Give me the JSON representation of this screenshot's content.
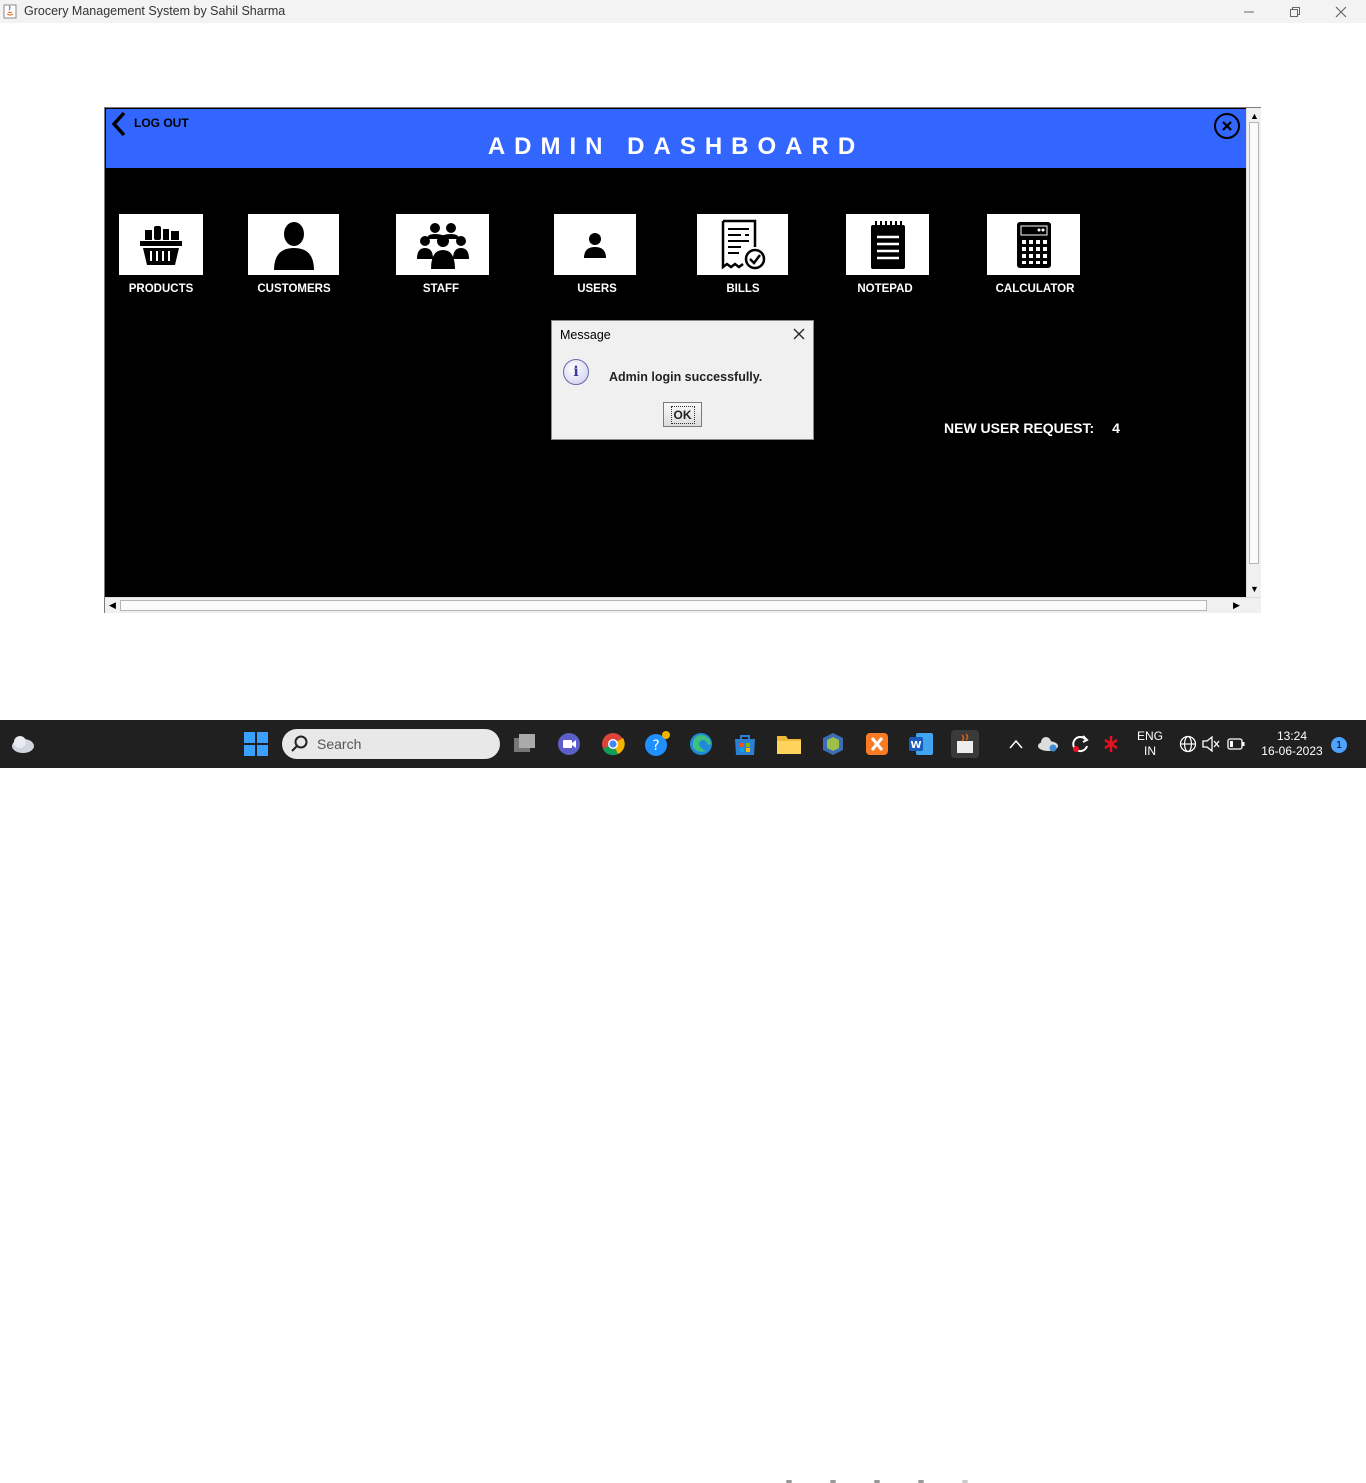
{
  "window": {
    "title": "Grocery Management System by Sahil Sharma"
  },
  "header": {
    "logout_label": "LOG OUT",
    "title": "ADMIN DASHBOARD"
  },
  "tiles": [
    {
      "label": "PRODUCTS",
      "icon": "grocery-basket-icon"
    },
    {
      "label": "CUSTOMERS",
      "icon": "person-icon"
    },
    {
      "label": "STAFF",
      "icon": "group-icon"
    },
    {
      "label": "USERS",
      "icon": "user-icon"
    },
    {
      "label": "BILLS",
      "icon": "bill-check-icon"
    },
    {
      "label": "NOTEPAD",
      "icon": "notepad-icon"
    },
    {
      "label": "CALCULATOR",
      "icon": "calculator-icon"
    }
  ],
  "requests": {
    "label": "NEW USER REQUEST:",
    "count": "4"
  },
  "dialog": {
    "title": "Message",
    "message": "Admin login successfully.",
    "ok_label": "OK"
  },
  "taskbar": {
    "search_placeholder": "Search",
    "language": "ENG",
    "region": "IN",
    "time": "13:24",
    "date": "16-06-2023",
    "notification_count": "1"
  },
  "colors": {
    "header_bg": "#3366ff",
    "content_bg": "#000000",
    "tile_bg": "#ffffff"
  }
}
